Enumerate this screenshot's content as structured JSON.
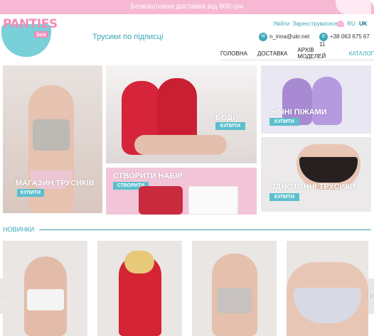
{
  "topbar": {
    "promo": "Безкоштовна доставка від 800 грн"
  },
  "logo": {
    "name": "PANTIES",
    "sub": "box"
  },
  "header": {
    "tagline": "Трусики по підписці",
    "login": "Увійти",
    "register": "Зареєструватися",
    "lang_ru": "RU",
    "lang_uk": "UK",
    "email": "n_inna@ukr.net",
    "phone": "+38 063 675 67 11"
  },
  "nav": {
    "items": [
      "ГОЛОВНА",
      "ДОСТАВКА",
      "АРХІВ МОДЕЛЕЙ",
      "КАТАЛОГ"
    ]
  },
  "tiles": {
    "shop": {
      "title": "МАГАЗИН ТРУСИКІВ",
      "button": "КУПИТИ"
    },
    "bodies": {
      "title": "БОДІ",
      "button": "КУПИТИ"
    },
    "set": {
      "title": "СТВОРИТИ НАБІР",
      "button": "СТВОРИТИ"
    },
    "pajamas": {
      "title": "НІЧНІ ПІЖАМИ",
      "button": "КУПИТИ"
    },
    "plain": {
      "title": "ОДНОТОННІ ТРУСИКИ",
      "button": "КУПИТИ"
    }
  },
  "section": {
    "title": "НОВИНКИ"
  },
  "icons": {
    "email": "mail-icon",
    "phone": "phone-icon",
    "cart": "heart-icon"
  },
  "colors": {
    "accent": "#3aa7b6",
    "pink": "#f6b8d2",
    "button": "#5cbfcd"
  }
}
